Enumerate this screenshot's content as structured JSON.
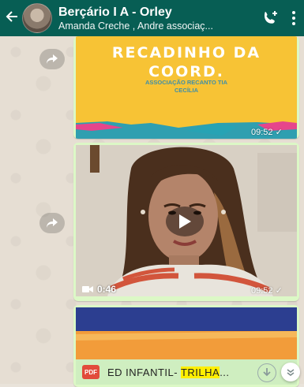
{
  "header": {
    "title": "Berçário I A - Orley",
    "subtitle": "Amanda Creche , Andre associaç..."
  },
  "messages": [
    {
      "type": "image",
      "heading_line1": "RECADINHO DA",
      "heading_line2": "COORD.",
      "caption_line1": "ASSOCIAÇÃO RECANTO TIA",
      "caption_line2": "CECÍLIA",
      "time": "09:52"
    },
    {
      "type": "video",
      "duration": "0:46",
      "time": "09:52"
    },
    {
      "type": "document",
      "badge": "PDF",
      "name_prefix": "ED INFANTIL- ",
      "name_highlight": "TRILHA",
      "name_suffix": "..."
    }
  ],
  "colors": {
    "header": "#075e54",
    "bubble": "#dcf8c6",
    "poster_yellow": "#f7c335",
    "pdf_red": "#e24b3b",
    "highlight": "#ffef00"
  },
  "icons": [
    "back-arrow-icon",
    "add-call-icon",
    "more-options-icon",
    "forward-icon",
    "play-icon",
    "video-camera-icon",
    "check-icon",
    "download-icon",
    "chevron-down-icon"
  ]
}
